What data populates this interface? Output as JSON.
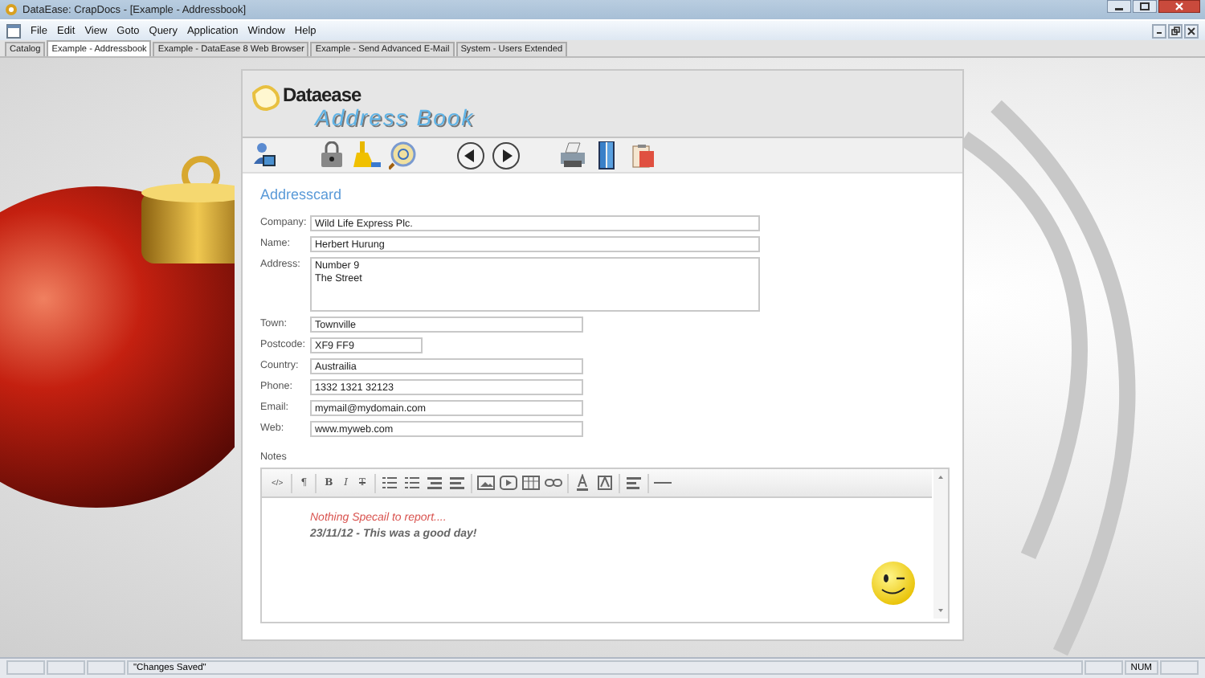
{
  "window": {
    "title": "DataEase: CrapDocs - [Example - Addressbook]"
  },
  "menu": [
    "File",
    "Edit",
    "View",
    "Goto",
    "Query",
    "Application",
    "Window",
    "Help"
  ],
  "tabs": [
    {
      "label": "Catalog",
      "selected": false
    },
    {
      "label": "Example - Addressbook",
      "selected": true
    },
    {
      "label": "Example - DataEase 8 Web Browser",
      "selected": false
    },
    {
      "label": "Example - Send Advanced E-Mail",
      "selected": false
    },
    {
      "label": "System - Users Extended",
      "selected": false
    }
  ],
  "logo": {
    "brand": "Dataease",
    "product": "Address Book"
  },
  "card": {
    "title": "Addresscard",
    "fields": [
      {
        "label": "Company:",
        "value": "Wild Life Express Plc.",
        "kind": "wide"
      },
      {
        "label": "Name:",
        "value": "Herbert Hurung",
        "kind": "wide"
      },
      {
        "label": "Address:",
        "value": "Number 9\nThe Street",
        "kind": "multiline"
      },
      {
        "label": "Town:",
        "value": "Townville",
        "kind": "medium"
      },
      {
        "label": "Postcode:",
        "value": "XF9 FF9",
        "kind": "short"
      },
      {
        "label": "Country:",
        "value": "Austrailia",
        "kind": "medium"
      },
      {
        "label": "Phone:",
        "value": "1332 1321 32123",
        "kind": "medium"
      },
      {
        "label": "Email:",
        "value": "mymail@mydomain.com",
        "kind": "medium"
      },
      {
        "label": "Web:",
        "value": "www.myweb.com",
        "kind": "medium"
      }
    ],
    "notes": {
      "label": "Notes",
      "glyphs": [
        {
          "text": "</>",
          "kind": "code"
        },
        {
          "text": "¶",
          "kind": "para"
        },
        {
          "text": "B",
          "kind": "bold"
        },
        {
          "text": "I",
          "kind": "italic"
        },
        {
          "text": "T",
          "kind": "strike"
        }
      ],
      "lines": [
        {
          "text": "Nothing Specail to report....",
          "kind": "italic",
          "color": "#d9534f"
        },
        {
          "text": "23/11/12 - This was a good day!",
          "kind": "bold-italic",
          "color": "#666666"
        }
      ]
    }
  },
  "status_bar": {
    "message": "\"Changes Saved\"",
    "indicator": "NUM"
  }
}
